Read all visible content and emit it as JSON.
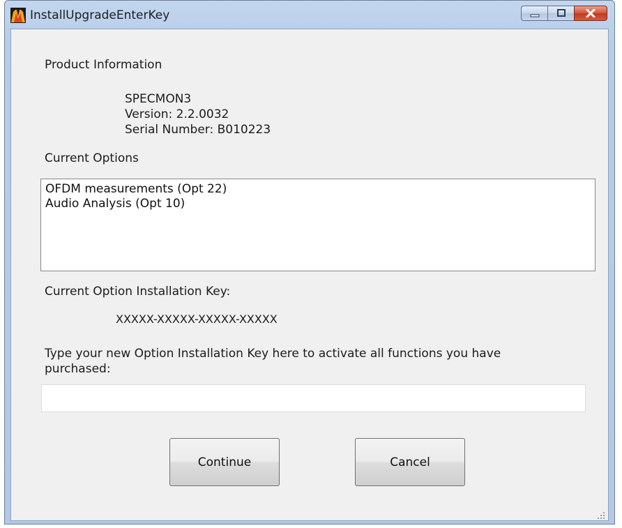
{
  "window": {
    "title": "InstallUpgradeEnterKey"
  },
  "product_info": {
    "heading": "Product Information",
    "name": "SPECMON3",
    "version": "Version: 2.2.0032",
    "serial": "Serial Number: B010223"
  },
  "current_options": {
    "heading": "Current Options",
    "items": [
      "OFDM measurements (Opt 22)",
      "Audio Analysis (Opt 10)"
    ]
  },
  "installation_key": {
    "heading": "Current Option Installation Key:",
    "value": "XXXXX-XXXXX-XXXXX-XXXXX"
  },
  "new_key": {
    "prompt_line1": "Type your new Option Installation Key here to activate all functions you have",
    "prompt_line2": "purchased:",
    "value": ""
  },
  "buttons": {
    "continue_label": "Continue",
    "cancel_label": "Cancel"
  },
  "icons": {
    "app": "app-logo-icon",
    "minimize": "minimize-icon",
    "maximize": "maximize-icon",
    "close": "close-icon",
    "resize": "resize-grip-icon"
  },
  "colors": {
    "title_bar": "#b7cde9",
    "close_button": "#c13a1f",
    "dialog_background": "#f0f0f0"
  }
}
